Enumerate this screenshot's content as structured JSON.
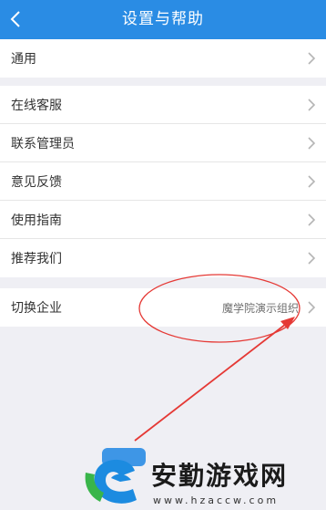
{
  "header": {
    "title": "设置与帮助"
  },
  "groups": [
    {
      "items": [
        {
          "label": "通用"
        }
      ]
    },
    {
      "items": [
        {
          "label": "在线客服"
        },
        {
          "label": "联系管理员"
        },
        {
          "label": "意见反馈"
        },
        {
          "label": "使用指南"
        },
        {
          "label": "推荐我们"
        }
      ]
    },
    {
      "items": [
        {
          "label": "切换企业",
          "value": "魔学院演示组织"
        }
      ]
    }
  ],
  "watermark": {
    "brand": "安勤游戏网",
    "domain": "www.hzaccw.com"
  },
  "colors": {
    "header": "#2a8ce4",
    "annotation": "#e53935"
  }
}
